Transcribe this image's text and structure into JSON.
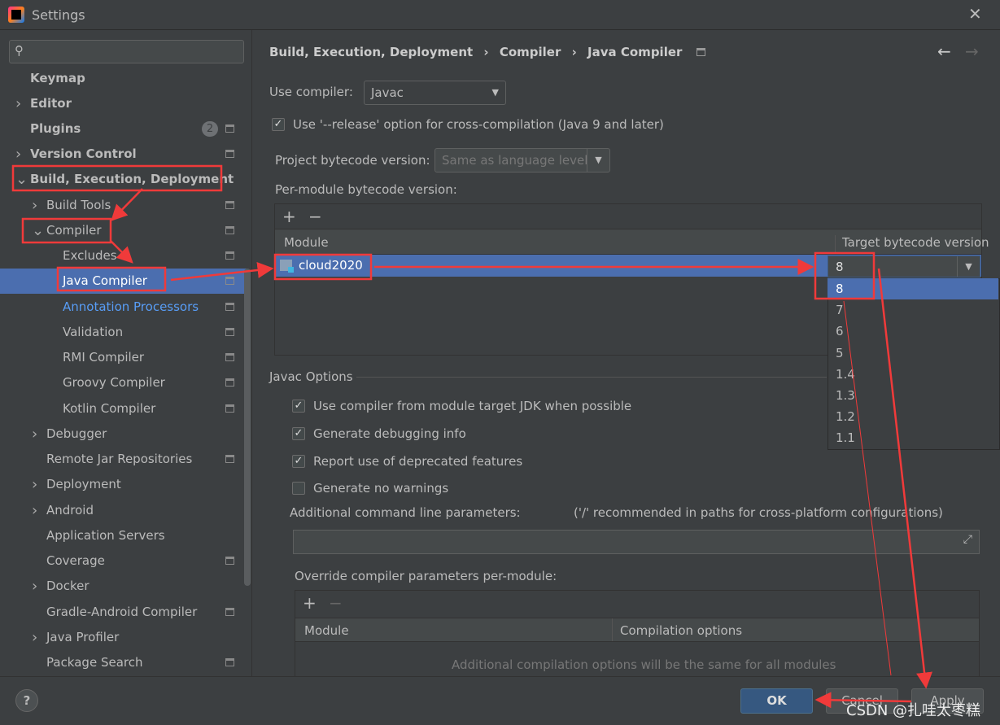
{
  "window": {
    "title": "Settings",
    "close_icon": "close-icon"
  },
  "sidebar": {
    "search_placeholder": "",
    "items": [
      {
        "label": "Keymap",
        "level": 0,
        "bold": true
      },
      {
        "label": "Editor",
        "level": 0,
        "bold": true,
        "expand": ">"
      },
      {
        "label": "Plugins",
        "level": 0,
        "bold": true,
        "badge": "2",
        "gear": true
      },
      {
        "label": "Version Control",
        "level": 0,
        "bold": true,
        "expand": ">",
        "gear": true
      },
      {
        "label": "Build, Execution, Deployment",
        "level": 0,
        "bold": true,
        "expand": "v"
      },
      {
        "label": "Build Tools",
        "level": 1,
        "expand": ">",
        "gear": true
      },
      {
        "label": "Compiler",
        "level": 1,
        "expand": "v",
        "gear": true
      },
      {
        "label": "Excludes",
        "level": 2,
        "gear": true
      },
      {
        "label": "Java Compiler",
        "level": 2,
        "gear": true,
        "selected": true
      },
      {
        "label": "Annotation Processors",
        "level": 2,
        "gear": true,
        "link": true
      },
      {
        "label": "Validation",
        "level": 2,
        "gear": true
      },
      {
        "label": "RMI Compiler",
        "level": 2,
        "gear": true
      },
      {
        "label": "Groovy Compiler",
        "level": 2,
        "gear": true
      },
      {
        "label": "Kotlin Compiler",
        "level": 2,
        "gear": true
      },
      {
        "label": "Debugger",
        "level": 1,
        "expand": ">"
      },
      {
        "label": "Remote Jar Repositories",
        "level": 1,
        "gear": true
      },
      {
        "label": "Deployment",
        "level": 1,
        "expand": ">"
      },
      {
        "label": "Android",
        "level": 1,
        "expand": ">"
      },
      {
        "label": "Application Servers",
        "level": 1
      },
      {
        "label": "Coverage",
        "level": 1,
        "gear": true
      },
      {
        "label": "Docker",
        "level": 1,
        "expand": ">"
      },
      {
        "label": "Gradle-Android Compiler",
        "level": 1,
        "gear": true
      },
      {
        "label": "Java Profiler",
        "level": 1,
        "expand": ">"
      },
      {
        "label": "Package Search",
        "level": 1,
        "gear": true
      }
    ]
  },
  "breadcrumb": {
    "parts": [
      "Build, Execution, Deployment",
      "Compiler",
      "Java Compiler"
    ],
    "sep": "›"
  },
  "main": {
    "use_compiler_label": "Use compiler:",
    "use_compiler_value": "Javac",
    "release_option": {
      "label": "Use '--release' option for cross-compilation (Java 9 and later)",
      "checked": true
    },
    "project_bytecode_label": "Project bytecode version:",
    "project_bytecode_value": "Same as language level",
    "per_module_label": "Per-module bytecode version:",
    "table": {
      "headers": [
        "Module",
        "Target bytecode version"
      ],
      "rows": [
        {
          "module": "cloud2020",
          "target": "8"
        }
      ]
    },
    "dropdown_options": [
      "8",
      "7",
      "6",
      "5",
      "1.4",
      "1.3",
      "1.2",
      "1.1"
    ],
    "javac_options_title": "Javac Options",
    "javac_checks": [
      {
        "label": "Use compiler from module target JDK when possible",
        "checked": true
      },
      {
        "label": "Generate debugging info",
        "checked": true
      },
      {
        "label": "Report use of deprecated features",
        "checked": true
      },
      {
        "label": "Generate no warnings",
        "checked": false
      }
    ],
    "additional_label": "Additional command line parameters:",
    "additional_hint": "('/' recommended in paths for cross-platform configurations)",
    "additional_value": "",
    "override_label": "Override compiler parameters per-module:",
    "override_headers": [
      "Module",
      "Compilation options"
    ],
    "override_empty": "Additional compilation options will be the same for all modules"
  },
  "footer": {
    "ok": "OK",
    "cancel": "Cancel",
    "apply": "Apply",
    "help": "?"
  },
  "watermark": "CSDN @扎哇太枣糕",
  "colors": {
    "selection": "#4b6eaf",
    "annotation": "#f03a3a",
    "link": "#589df6"
  }
}
